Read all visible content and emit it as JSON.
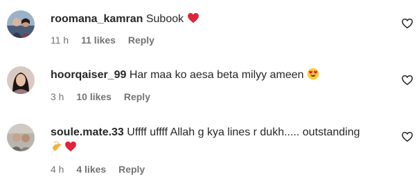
{
  "comments": [
    {
      "username": "roomana_kamran",
      "text": "Subook",
      "emojis": [
        "red-heart"
      ],
      "time": "11 h",
      "likes": "11 likes",
      "reply": "Reply"
    },
    {
      "username": "hoorqaiser_99",
      "text": "Har maa ko aesa beta milyy ameen",
      "emojis": [
        "heart-eyes"
      ],
      "time": "3 h",
      "likes": "10 likes",
      "reply": "Reply"
    },
    {
      "username": "soule.mate.33",
      "text": "Uffff uffff Allah g kya lines r dukh..... outstanding",
      "emojis": [
        "clapping-hands",
        "red-heart"
      ],
      "time": "4 h",
      "likes": "4 likes",
      "reply": "Reply"
    }
  ],
  "colors": {
    "text": "#262626",
    "meta": "#737373",
    "heart": "#e0243a"
  },
  "icons": {
    "like": "heart-outline-icon"
  }
}
